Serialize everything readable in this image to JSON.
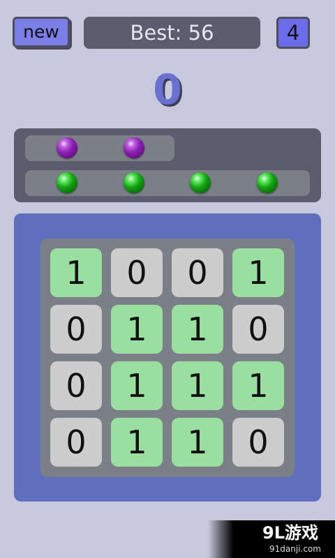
{
  "header": {
    "new_label": "new",
    "best_text": "Best: 56",
    "level": "4"
  },
  "score": "0",
  "indicators": {
    "row1": [
      "purple",
      "purple"
    ],
    "row2": [
      "green",
      "green",
      "green",
      "green"
    ]
  },
  "board": {
    "rows": [
      [
        "1",
        "0",
        "0",
        "1"
      ],
      [
        "0",
        "1",
        "1",
        "0"
      ],
      [
        "0",
        "1",
        "1",
        "1"
      ],
      [
        "0",
        "1",
        "1",
        "0"
      ]
    ]
  },
  "colors": {
    "background": "#c8c8dc",
    "accent": "#7a7ee6",
    "score": "#6a70d0",
    "cell_on": "#9adea0",
    "cell_off": "#cdcdcd",
    "board_frame": "#5f6fbe"
  },
  "watermark": {
    "logo": "9L游戏",
    "url": "91danji.com"
  }
}
